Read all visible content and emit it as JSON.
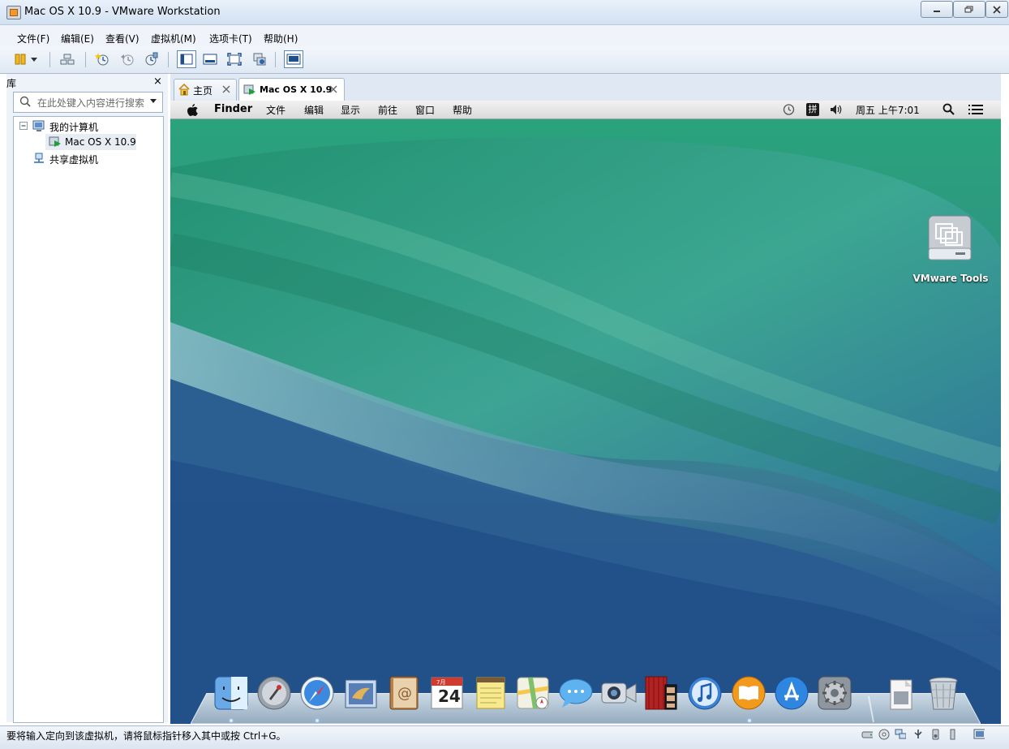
{
  "window": {
    "title": "Mac OS X 10.9 - VMware Workstation"
  },
  "menubar": {
    "items": [
      {
        "label": "文件(F)"
      },
      {
        "label": "编辑(E)"
      },
      {
        "label": "查看(V)"
      },
      {
        "label": "虚拟机(M)"
      },
      {
        "label": "选项卡(T)"
      },
      {
        "label": "帮助(H)"
      }
    ]
  },
  "toolbar": {
    "icons": [
      "pause-icon",
      "dropdown-icon",
      "send-ctrl-alt-del-icon",
      "snapshot-icon",
      "revert-snapshot-icon",
      "snapshot-manager-icon",
      "console-view-icon",
      "quick-switch-icon",
      "fullscreen-icon",
      "unity-icon",
      "thumbnail-view-icon"
    ]
  },
  "sidebar": {
    "title": "库",
    "close_glyph": "×",
    "search_placeholder": "在此处键入内容进行搜索",
    "tree": {
      "my_computer": "我的计算机",
      "vm_item": "Mac OS X 10.9",
      "shared": "共享虚拟机"
    }
  },
  "tabs": [
    {
      "label": "主页",
      "icon": "home-icon"
    },
    {
      "label": "Mac OS X 10.9",
      "icon": "vm-running-icon",
      "active": true
    }
  ],
  "guest": {
    "menubar": {
      "app": "Finder",
      "items": [
        "文件",
        "编辑",
        "显示",
        "前往",
        "窗口",
        "帮助"
      ],
      "clock": "周五 上午7:01",
      "input_method": "拼"
    },
    "desktop": {
      "icon_label": "VMware Tools"
    },
    "dock": {
      "calendar_month": "7月",
      "calendar_day": "24",
      "apps": [
        "finder-icon",
        "launchpad-icon",
        "safari-icon",
        "mail-icon",
        "contacts-icon",
        "calendar-icon",
        "notes-icon",
        "maps-icon",
        "messages-icon",
        "facetime-icon",
        "photo-booth-icon",
        "itunes-icon",
        "ibooks-icon",
        "app-store-icon",
        "system-preferences-icon",
        "downloads-stack-icon",
        "trash-icon"
      ]
    }
  },
  "statusbar": {
    "message": "要将输入定向到该虚拟机，请将鼠标指针移入其中或按 Ctrl+G。"
  },
  "colors": {
    "chrome_blue": "#d2e1f2",
    "wave_green": "#2fa37c",
    "wave_blue": "#2f5f95"
  }
}
